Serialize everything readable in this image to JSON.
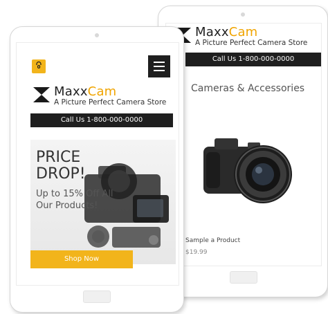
{
  "store": {
    "brand_prefix": "Maxx",
    "brand_highlight": "Cam",
    "tagline": "A Picture Perfect Camera Store",
    "call_us": "Call Us 1-800-000-0000"
  },
  "back_screen": {
    "call_us": "Call Us 1-800-000-0000",
    "section_title": "Cameras & Accessories",
    "product_name": "Sample a Product",
    "product_price": "$19.99"
  },
  "front_screen": {
    "cart_count": "0",
    "hero_headline_line1": "PRICE",
    "hero_headline_line2": "DROP!",
    "hero_sub_line1": "Up to 15% Off All",
    "hero_sub_line2": "Our Products!",
    "shop_now_label": "Shop Now"
  },
  "colors": {
    "accent": "#f2b41b",
    "brand_highlight": "#f0a400",
    "dark_bar": "#1f1f1f"
  },
  "icons": {
    "cart": "shopping-bag-icon",
    "menu": "hamburger-menu-icon",
    "logo": "maxxcam-logo-icon"
  }
}
